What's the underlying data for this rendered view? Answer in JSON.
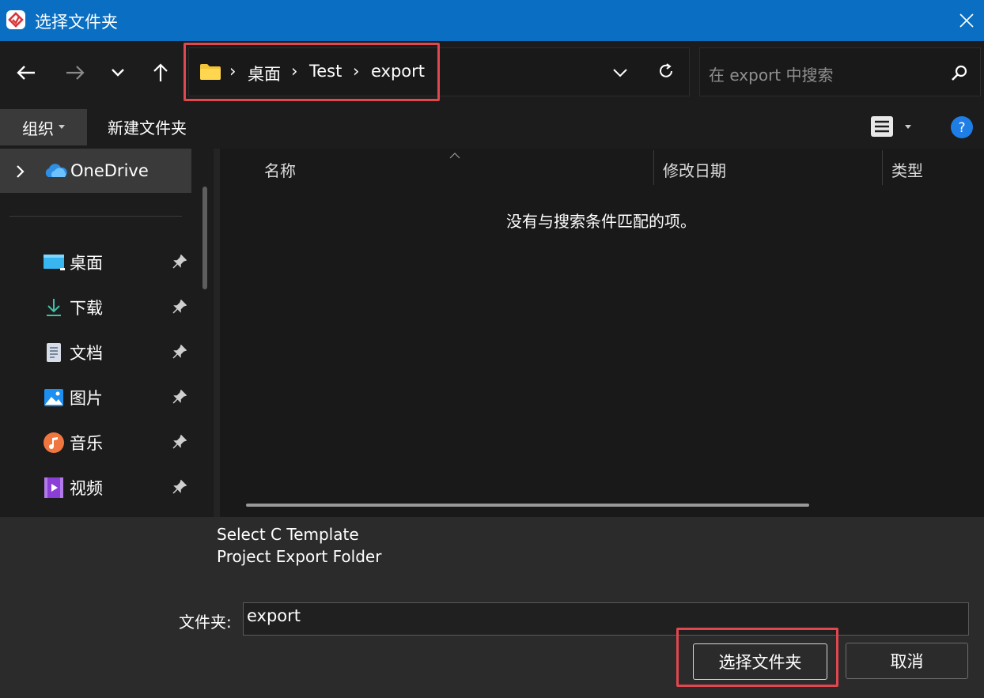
{
  "window": {
    "title": "选择文件夹",
    "accent": "#0a6fc2",
    "highlight": "#e0474f"
  },
  "nav": {
    "breadcrumb": [
      "桌面",
      "Test",
      "export"
    ],
    "search_placeholder": "在 export 中搜索"
  },
  "toolbar": {
    "organize_label": "组织",
    "new_folder_label": "新建文件夹"
  },
  "sidebar": {
    "onedrive_label": "OneDrive",
    "items": [
      {
        "label": "桌面",
        "icon": "desktop-icon"
      },
      {
        "label": "下载",
        "icon": "download-icon"
      },
      {
        "label": "文档",
        "icon": "document-icon"
      },
      {
        "label": "图片",
        "icon": "picture-icon"
      },
      {
        "label": "音乐",
        "icon": "music-icon"
      },
      {
        "label": "视频",
        "icon": "video-icon"
      }
    ]
  },
  "list": {
    "columns": [
      "名称",
      "修改日期",
      "类型"
    ],
    "empty_message": "没有与搜索条件匹配的项。"
  },
  "bottom": {
    "description_line1": "Select C Template",
    "description_line2": "Project Export Folder",
    "folder_label": "文件夹:",
    "folder_value": "export",
    "select_button": "选择文件夹",
    "cancel_button": "取消"
  }
}
